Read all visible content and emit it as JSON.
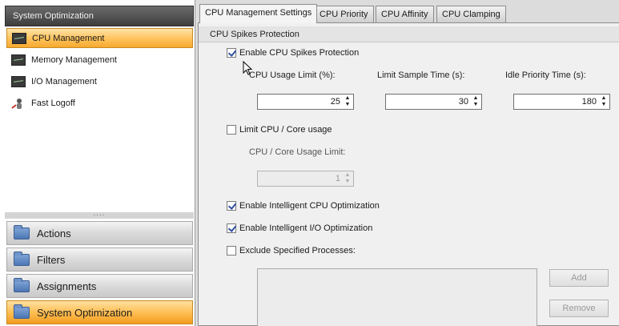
{
  "nav": {
    "header": "System Optimization",
    "items": [
      {
        "label": "CPU Management",
        "icon": "cpu-monitor-icon"
      },
      {
        "label": "Memory Management",
        "icon": "memory-monitor-icon"
      },
      {
        "label": "I/O Management",
        "icon": "io-monitor-icon"
      },
      {
        "label": "Fast Logoff",
        "icon": "fast-logoff-icon"
      }
    ],
    "splitter": "....",
    "groups": [
      {
        "label": "Actions"
      },
      {
        "label": "Filters"
      },
      {
        "label": "Assignments"
      },
      {
        "label": "System Optimization"
      }
    ]
  },
  "tabs": [
    {
      "label": "CPU Management Settings"
    },
    {
      "label": "CPU Priority"
    },
    {
      "label": "CPU Affinity"
    },
    {
      "label": "CPU Clamping"
    }
  ],
  "section": {
    "title": "CPU Spikes Protection",
    "enable_spikes": {
      "label": "Enable CPU Spikes Protection",
      "checked": true
    },
    "usage_limit": {
      "label": "CPU Usage Limit (%):",
      "value": "25"
    },
    "sample_time": {
      "label": "Limit Sample Time (s):",
      "value": "30"
    },
    "idle_priority": {
      "label": "Idle Priority Time (s):",
      "value": "180"
    },
    "limit_core": {
      "label": "Limit CPU / Core  usage",
      "checked": false
    },
    "core_limit": {
      "label": "CPU / Core Usage Limit:",
      "value": "1"
    },
    "intelligent_cpu": {
      "label": "Enable Intelligent CPU Optimization",
      "checked": true
    },
    "intelligent_io": {
      "label": "Enable Intelligent I/O Optimization",
      "checked": true
    },
    "exclude": {
      "label": "Exclude Specified Processes:",
      "checked": false
    },
    "add_label": "Add",
    "remove_label": "Remove"
  },
  "colors": {
    "active_orange": "#ffbf55",
    "header_dark": "#4a4a4a",
    "checkmark": "#2e4fa0"
  }
}
